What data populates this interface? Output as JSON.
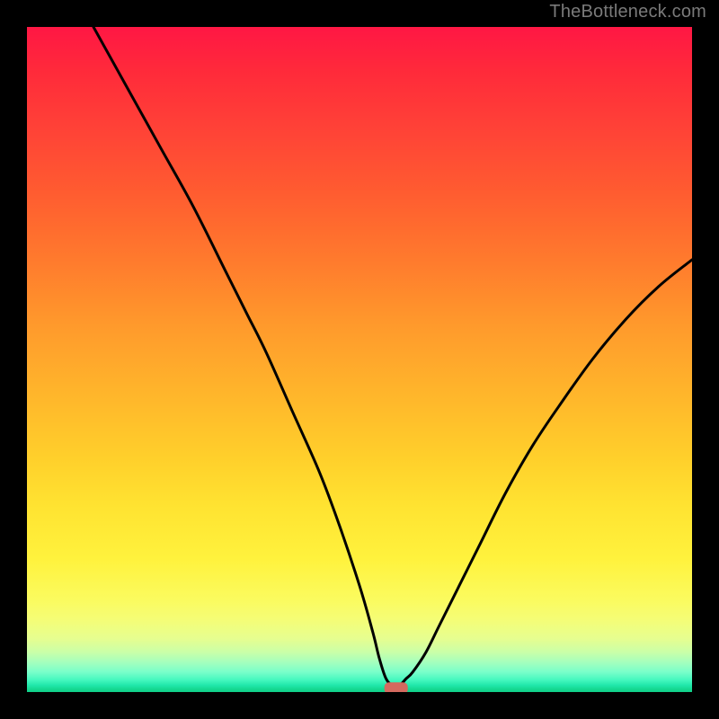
{
  "watermark": "TheBottleneck.com",
  "chart_data": {
    "type": "line",
    "title": "",
    "xlabel": "",
    "ylabel": "",
    "xlim": [
      0,
      100
    ],
    "ylim": [
      0,
      100
    ],
    "grid": false,
    "series": [
      {
        "name": "bottleneck-curve",
        "x": [
          10,
          15,
          20,
          25,
          30,
          33,
          36,
          40,
          44,
          47,
          50,
          52,
          53,
          54,
          55,
          56,
          57,
          58,
          60,
          62,
          65,
          68,
          72,
          76,
          80,
          85,
          90,
          95,
          100
        ],
        "y": [
          100,
          91,
          82,
          73,
          63,
          57,
          51,
          42,
          33,
          25,
          16,
          9,
          5,
          2,
          1,
          1,
          2,
          3,
          6,
          10,
          16,
          22,
          30,
          37,
          43,
          50,
          56,
          61,
          65
        ]
      }
    ],
    "annotations": [
      {
        "kind": "marker",
        "name": "optimal-marker",
        "shape": "rounded-rect",
        "x": 55.5,
        "y": 0.5,
        "color": "#d46a5f"
      }
    ],
    "background_gradient": {
      "orientation": "vertical",
      "stops": [
        {
          "offset": 0.0,
          "color": "#ff1744"
        },
        {
          "offset": 0.5,
          "color": "#ffb52b"
        },
        {
          "offset": 0.8,
          "color": "#fff23d"
        },
        {
          "offset": 0.93,
          "color": "#d8ff9a"
        },
        {
          "offset": 1.0,
          "color": "#11cf89"
        }
      ]
    }
  }
}
